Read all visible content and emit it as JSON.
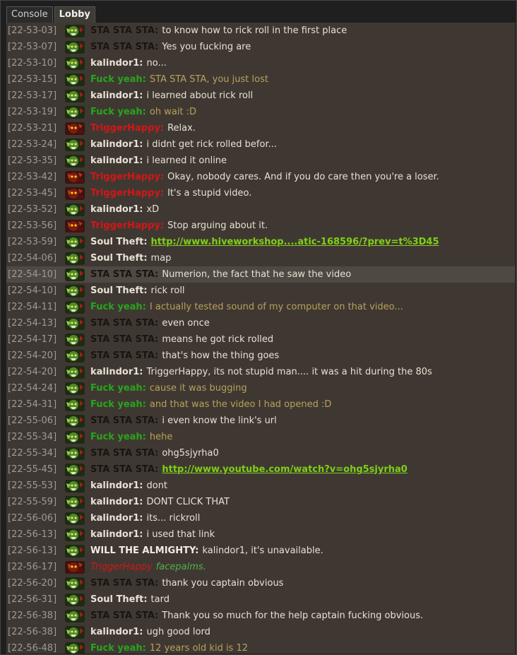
{
  "tabs": [
    {
      "label": "Console"
    },
    {
      "label": "Lobby"
    }
  ],
  "colors": {
    "STA STA STA": "#1a1410",
    "kalindor1": "#e8e1d5",
    "Fuck yeah": "#28a51d",
    "TriggerHappy": "#d21717",
    "Soul Theft": "#e8e1d5",
    "WILL THE ALMIGHTY": "#f2ece2",
    "link": "#7fcf18"
  },
  "messages": [
    {
      "time": "[22-53-03]",
      "user": "STA STA STA:",
      "text": "to know how to rick roll in the first place",
      "avatar": "green-orc-icon"
    },
    {
      "time": "[22-53-07]",
      "user": "STA STA STA:",
      "text": "Yes you fucking are",
      "avatar": "green-orc-icon"
    },
    {
      "time": "[22-53-10]",
      "user": "kalindor1:",
      "text": "no...",
      "avatar": "green-orc-icon"
    },
    {
      "time": "[22-53-15]",
      "user": "Fuck yeah:",
      "text": "STA STA STA, you just lost",
      "avatar": "green-orc-icon"
    },
    {
      "time": "[22-53-17]",
      "user": "kalindor1:",
      "text": "i learned about rick roll",
      "avatar": "green-orc-icon"
    },
    {
      "time": "[22-53-19]",
      "user": "Fuck yeah:",
      "text": "oh wait :D",
      "avatar": "green-orc-icon"
    },
    {
      "time": "[22-53-21]",
      "user": "TriggerHappy:",
      "text": "Relax.",
      "avatar": "red-demon-icon"
    },
    {
      "time": "[22-53-24]",
      "user": "kalindor1:",
      "text": "i didnt get rick rolled befor...",
      "avatar": "green-orc-icon"
    },
    {
      "time": "[22-53-35]",
      "user": "kalindor1:",
      "text": "i learned it online",
      "avatar": "green-orc-icon"
    },
    {
      "time": "[22-53-42]",
      "user": "TriggerHappy:",
      "text": "Okay, nobody cares. And if you do care then you're a loser.",
      "avatar": "red-demon-icon"
    },
    {
      "time": "[22-53-45]",
      "user": "TriggerHappy:",
      "text": "It's a stupid video.",
      "avatar": "red-demon-icon"
    },
    {
      "time": "[22-53-52]",
      "user": "kalindor1:",
      "text": "xD",
      "avatar": "green-orc-icon"
    },
    {
      "time": "[22-53-56]",
      "user": "TriggerHappy:",
      "text": "Stop arguing about it.",
      "avatar": "red-demon-icon"
    },
    {
      "time": "[22-53-59]",
      "user": "Soul Theft:",
      "text": "http://www.hiveworkshop....atic-168596/?prev=t%3D45",
      "avatar": "green-orc-icon",
      "link": true
    },
    {
      "time": "[22-54-06]",
      "user": "Soul Theft:",
      "text": "map",
      "avatar": "green-orc-icon"
    },
    {
      "time": "[22-54-10]",
      "user": "STA STA STA:",
      "text": "Numerion, the fact that he saw the video",
      "avatar": "green-orc-icon",
      "highlight": true
    },
    {
      "time": "[22-54-10]",
      "user": "Soul Theft:",
      "text": "rick roll",
      "avatar": "green-orc-icon"
    },
    {
      "time": "[22-54-11]",
      "user": "Fuck yeah:",
      "text": "I actually tested sound of my computer on that video...",
      "avatar": "green-orc-icon"
    },
    {
      "time": "[22-54-13]",
      "user": "STA STA STA:",
      "text": "even once",
      "avatar": "green-orc-icon"
    },
    {
      "time": "[22-54-17]",
      "user": "STA STA STA:",
      "text": "means he got rick rolled",
      "avatar": "green-orc-icon"
    },
    {
      "time": "[22-54-20]",
      "user": "STA STA STA:",
      "text": "that's how the thing goes",
      "avatar": "green-orc-icon"
    },
    {
      "time": "[22-54-20]",
      "user": "kalindor1:",
      "text": "TriggerHappy, its not stupid man.... it was a hit during the 80s",
      "avatar": "green-orc-icon"
    },
    {
      "time": "[22-54-24]",
      "user": "Fuck yeah:",
      "text": "cause it was bugging",
      "avatar": "green-orc-icon"
    },
    {
      "time": "[22-54-31]",
      "user": "Fuck yeah:",
      "text": "and that was the video I had opened :D",
      "avatar": "green-orc-icon"
    },
    {
      "time": "[22-55-06]",
      "user": "STA STA STA:",
      "text": "i even know the link's url",
      "avatar": "green-orc-icon"
    },
    {
      "time": "[22-55-34]",
      "user": "Fuck yeah:",
      "text": "hehe",
      "avatar": "green-orc-icon"
    },
    {
      "time": "[22-55-34]",
      "user": "STA STA STA:",
      "text": "ohg5sjyrha0",
      "avatar": "green-orc-icon"
    },
    {
      "time": "[22-55-45]",
      "user": "STA STA STA:",
      "text": "http://www.youtube.com/watch?v=ohg5sjyrha0",
      "avatar": "green-orc-icon",
      "link": true
    },
    {
      "time": "[22-55-53]",
      "user": "kalindor1:",
      "text": "dont",
      "avatar": "green-orc-icon"
    },
    {
      "time": "[22-55-59]",
      "user": "kalindor1:",
      "text": "DONT CLICK THAT",
      "avatar": "green-orc-icon"
    },
    {
      "time": "[22-56-06]",
      "user": "kalindor1:",
      "text": "its... rickroll",
      "avatar": "green-orc-icon"
    },
    {
      "time": "[22-56-13]",
      "user": "kalindor1:",
      "text": "i used that link",
      "avatar": "green-orc-icon"
    },
    {
      "time": "[22-56-13]",
      "user": "WILL THE ALMIGHTY:",
      "text": "kalindor1, it's unavailable.",
      "avatar": "green-orc-icon"
    },
    {
      "time": "[22-56-17]",
      "user": "TriggerHappy",
      "text": "facepalms.",
      "avatar": "red-demon-icon",
      "emote": true
    },
    {
      "time": "[22-56-20]",
      "user": "STA STA STA:",
      "text": "thank you captain obvious",
      "avatar": "green-orc-icon"
    },
    {
      "time": "[22-56-31]",
      "user": "Soul Theft:",
      "text": "tard",
      "avatar": "green-orc-icon"
    },
    {
      "time": "[22-56-38]",
      "user": "STA STA STA:",
      "text": "Thank you so much for the help captain fucking obvious.",
      "avatar": "green-orc-icon"
    },
    {
      "time": "[22-56-38]",
      "user": "kalindor1:",
      "text": "ugh good lord",
      "avatar": "green-orc-icon"
    },
    {
      "time": "[22-56-48]",
      "user": "Fuck yeah:",
      "text": "12 years old kid is 12",
      "avatar": "green-orc-icon"
    }
  ]
}
